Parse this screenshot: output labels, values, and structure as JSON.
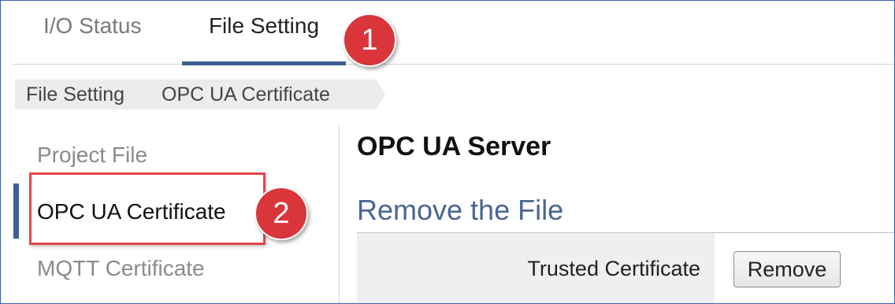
{
  "tabs": [
    {
      "label": "I/O Status",
      "active": false
    },
    {
      "label": "File Setting",
      "active": true
    }
  ],
  "annotations": {
    "step1": "1",
    "step2": "2",
    "color": "#d9353a"
  },
  "breadcrumb": [
    "File Setting",
    "OPC UA Certificate"
  ],
  "sidebar": {
    "items": [
      {
        "label": "Project File",
        "active": false
      },
      {
        "label": "OPC UA Certificate",
        "active": true
      },
      {
        "label": "MQTT Certificate",
        "active": false
      }
    ]
  },
  "main": {
    "title": "OPC UA Server",
    "section_title": "Remove the File",
    "rows": [
      {
        "label": "Trusted Certificate",
        "button_label": "Remove"
      }
    ]
  },
  "colors": {
    "accent": "#3f5f8f",
    "section_title": "#4a6594",
    "highlight": "#e0464b"
  }
}
